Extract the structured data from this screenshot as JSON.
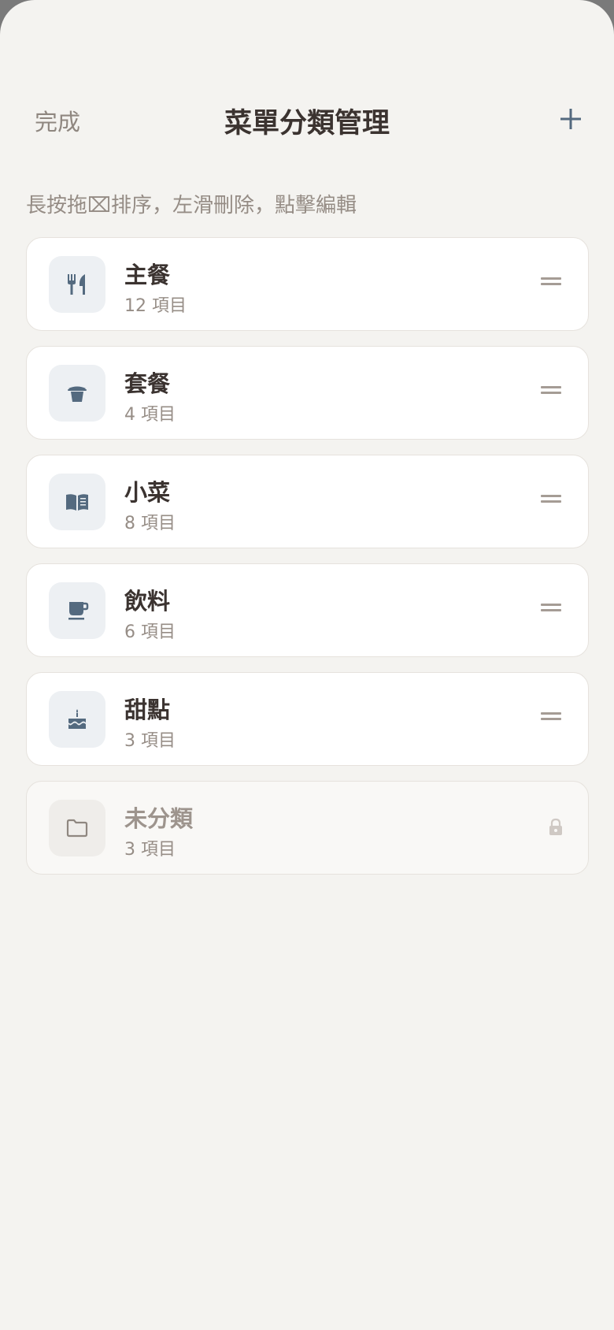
{
  "header": {
    "done_label": "完成",
    "title": "菜單分類管理",
    "add_icon": "plus-icon"
  },
  "hint": "長按拖⌧排序，左滑刪除，點擊編輯",
  "categories": [
    {
      "name": "主餐",
      "count": "12 項目",
      "icon": "fork-knife-icon"
    },
    {
      "name": "套餐",
      "count": "4 項目",
      "icon": "bento-box-icon"
    },
    {
      "name": "小菜",
      "count": "8 項目",
      "icon": "open-book-icon"
    },
    {
      "name": "飲料",
      "count": "6 項目",
      "icon": "coffee-cup-icon"
    },
    {
      "name": "甜點",
      "count": "3 項目",
      "icon": "cake-icon"
    },
    {
      "name": "未分類",
      "count": "3 項目",
      "icon": "folder-icon",
      "locked": true
    }
  ],
  "colors": {
    "background": "#f4f3f0",
    "card": "#ffffff",
    "accent": "#546a7f",
    "title_text": "#3b3330",
    "muted_text": "#968d86"
  }
}
